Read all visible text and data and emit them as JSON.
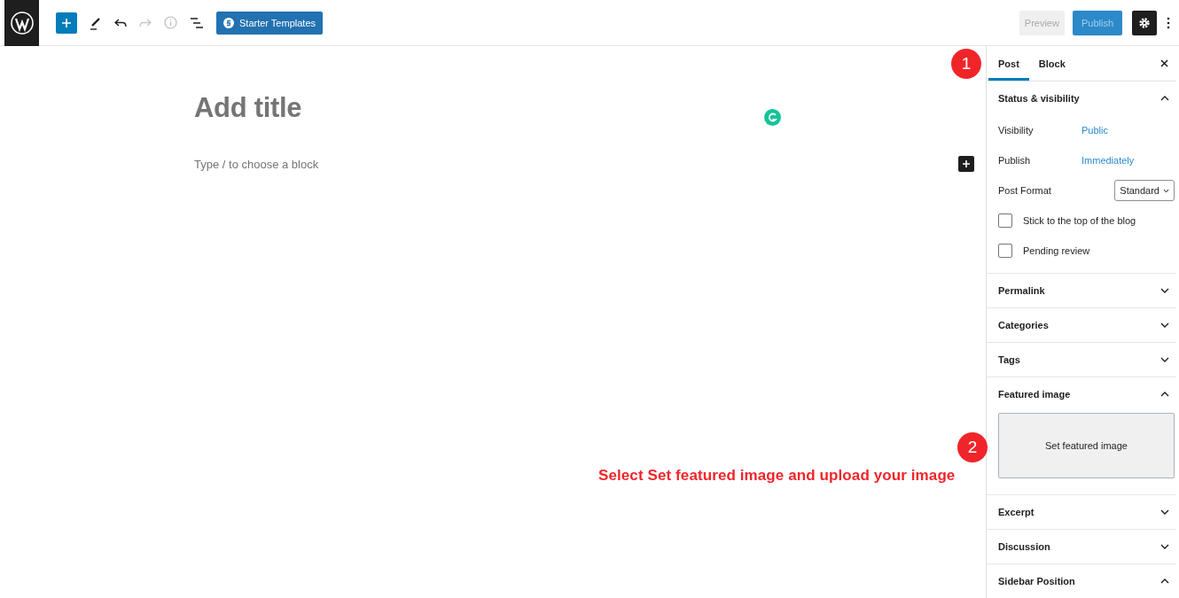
{
  "toolbar": {
    "templates_button": "Starter Templates",
    "preview_button": "Preview",
    "publish_button": "Publish",
    "settings_selected": true
  },
  "editor": {
    "title_placeholder": "Add title",
    "block_placeholder": "Type / to choose a block"
  },
  "sidebar": {
    "tabs": [
      {
        "label": "Post",
        "selected": true
      },
      {
        "label": "Block",
        "selected": false
      }
    ],
    "panels": [
      {
        "title": "Status & visibility",
        "expanded": true,
        "kind": "status",
        "rows": [
          {
            "label": "Visibility",
            "value": "Public"
          },
          {
            "label": "Publish",
            "value": "Immediately"
          }
        ],
        "post_format": {
          "label": "Post Format",
          "value": "Standard"
        },
        "checkboxes": [
          {
            "label": "Stick to the top of the blog",
            "checked": false
          },
          {
            "label": "Pending review",
            "checked": false
          }
        ]
      },
      {
        "title": "Permalink",
        "expanded": false
      },
      {
        "title": "Categories",
        "expanded": false
      },
      {
        "title": "Tags",
        "expanded": false
      },
      {
        "title": "Featured image",
        "expanded": true,
        "kind": "featured",
        "button": "Set featured image"
      },
      {
        "title": "Excerpt",
        "expanded": false
      },
      {
        "title": "Discussion",
        "expanded": false
      },
      {
        "title": "Sidebar Position",
        "expanded": true
      }
    ]
  },
  "annotations": [
    {
      "number": "1"
    },
    {
      "number": "2"
    }
  ],
  "instruction": "Select Set featured image and upload your image"
}
